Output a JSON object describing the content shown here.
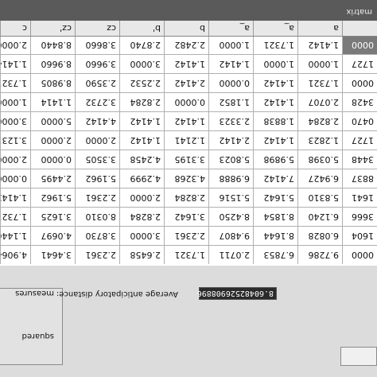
{
  "labels": {
    "squared": "squared",
    "measures": "measures",
    "avg_label": "Average anticipatory distance:",
    "avg_value": "8.60482526908896"
  },
  "columns": [
    "a",
    "a_",
    "a_",
    "b",
    "b'",
    "cz",
    "cz'",
    "c"
  ],
  "rows": [
    [
      "0000",
      "1.4142",
      "1.7321",
      "1.0000",
      "2.2482",
      "2.8740",
      "3.8660",
      "8.8440",
      "2.0000"
    ],
    [
      "1727",
      "1.0000",
      "1.0000",
      "1.4142",
      "1.4142",
      "3.0000",
      "3.9660",
      "8.9660",
      "1.1414"
    ],
    [
      "0000",
      "1.7321",
      "1.4142",
      "0.0000",
      "2.4142",
      "2.2532",
      "2.3590",
      "8.9805",
      "1.7321"
    ],
    [
      "3428",
      "2.0707",
      "1.4142",
      "1.1852",
      "0.0000",
      "2.8284",
      "3.2732",
      "1.1414",
      "1.0000"
    ],
    [
      "0470",
      "2.8284",
      "1.8838",
      "2.3323",
      "1.4142",
      "1.4142",
      "4.4142",
      "5.0000",
      "3.0000"
    ],
    [
      "1727",
      "1.2823",
      "1.4142",
      "2.4142",
      "1.2141",
      "1.4142",
      "2.0000",
      "2.0000",
      "3.1231"
    ],
    [
      "3448",
      "5.0398",
      "5.9898",
      "5.8023",
      "3.3195",
      "4.2458",
      "3.3505",
      "0.0000",
      "2.0000"
    ],
    [
      "8837",
      "6.9427",
      "7.4142",
      "6.9888",
      "4.3268",
      "4.2999",
      "5.1962",
      "2.4495",
      "0.0000"
    ],
    [
      "1641",
      "5.8310",
      "5.1642",
      "5.1516",
      "2.8284",
      "2.0000",
      "2.2361",
      "5.1962",
      "1.4142"
    ],
    [
      "3666",
      "6.1240",
      "8.1854",
      "8.4250",
      "3.1642",
      "2.8284",
      "8.0310",
      "3.1625",
      "1.7321"
    ],
    [
      "1604",
      "6.0828",
      "8.1644",
      "9.4807",
      "2.2361",
      "3.0000",
      "3.8730",
      "4.0697",
      "1.1446"
    ],
    [
      "0000",
      "9.7286",
      "6.7853",
      "2.0711",
      "1.7321",
      "2.6458",
      "2.2361",
      "3.4641",
      "4.9064"
    ]
  ],
  "status": {
    "label": "matrix"
  }
}
